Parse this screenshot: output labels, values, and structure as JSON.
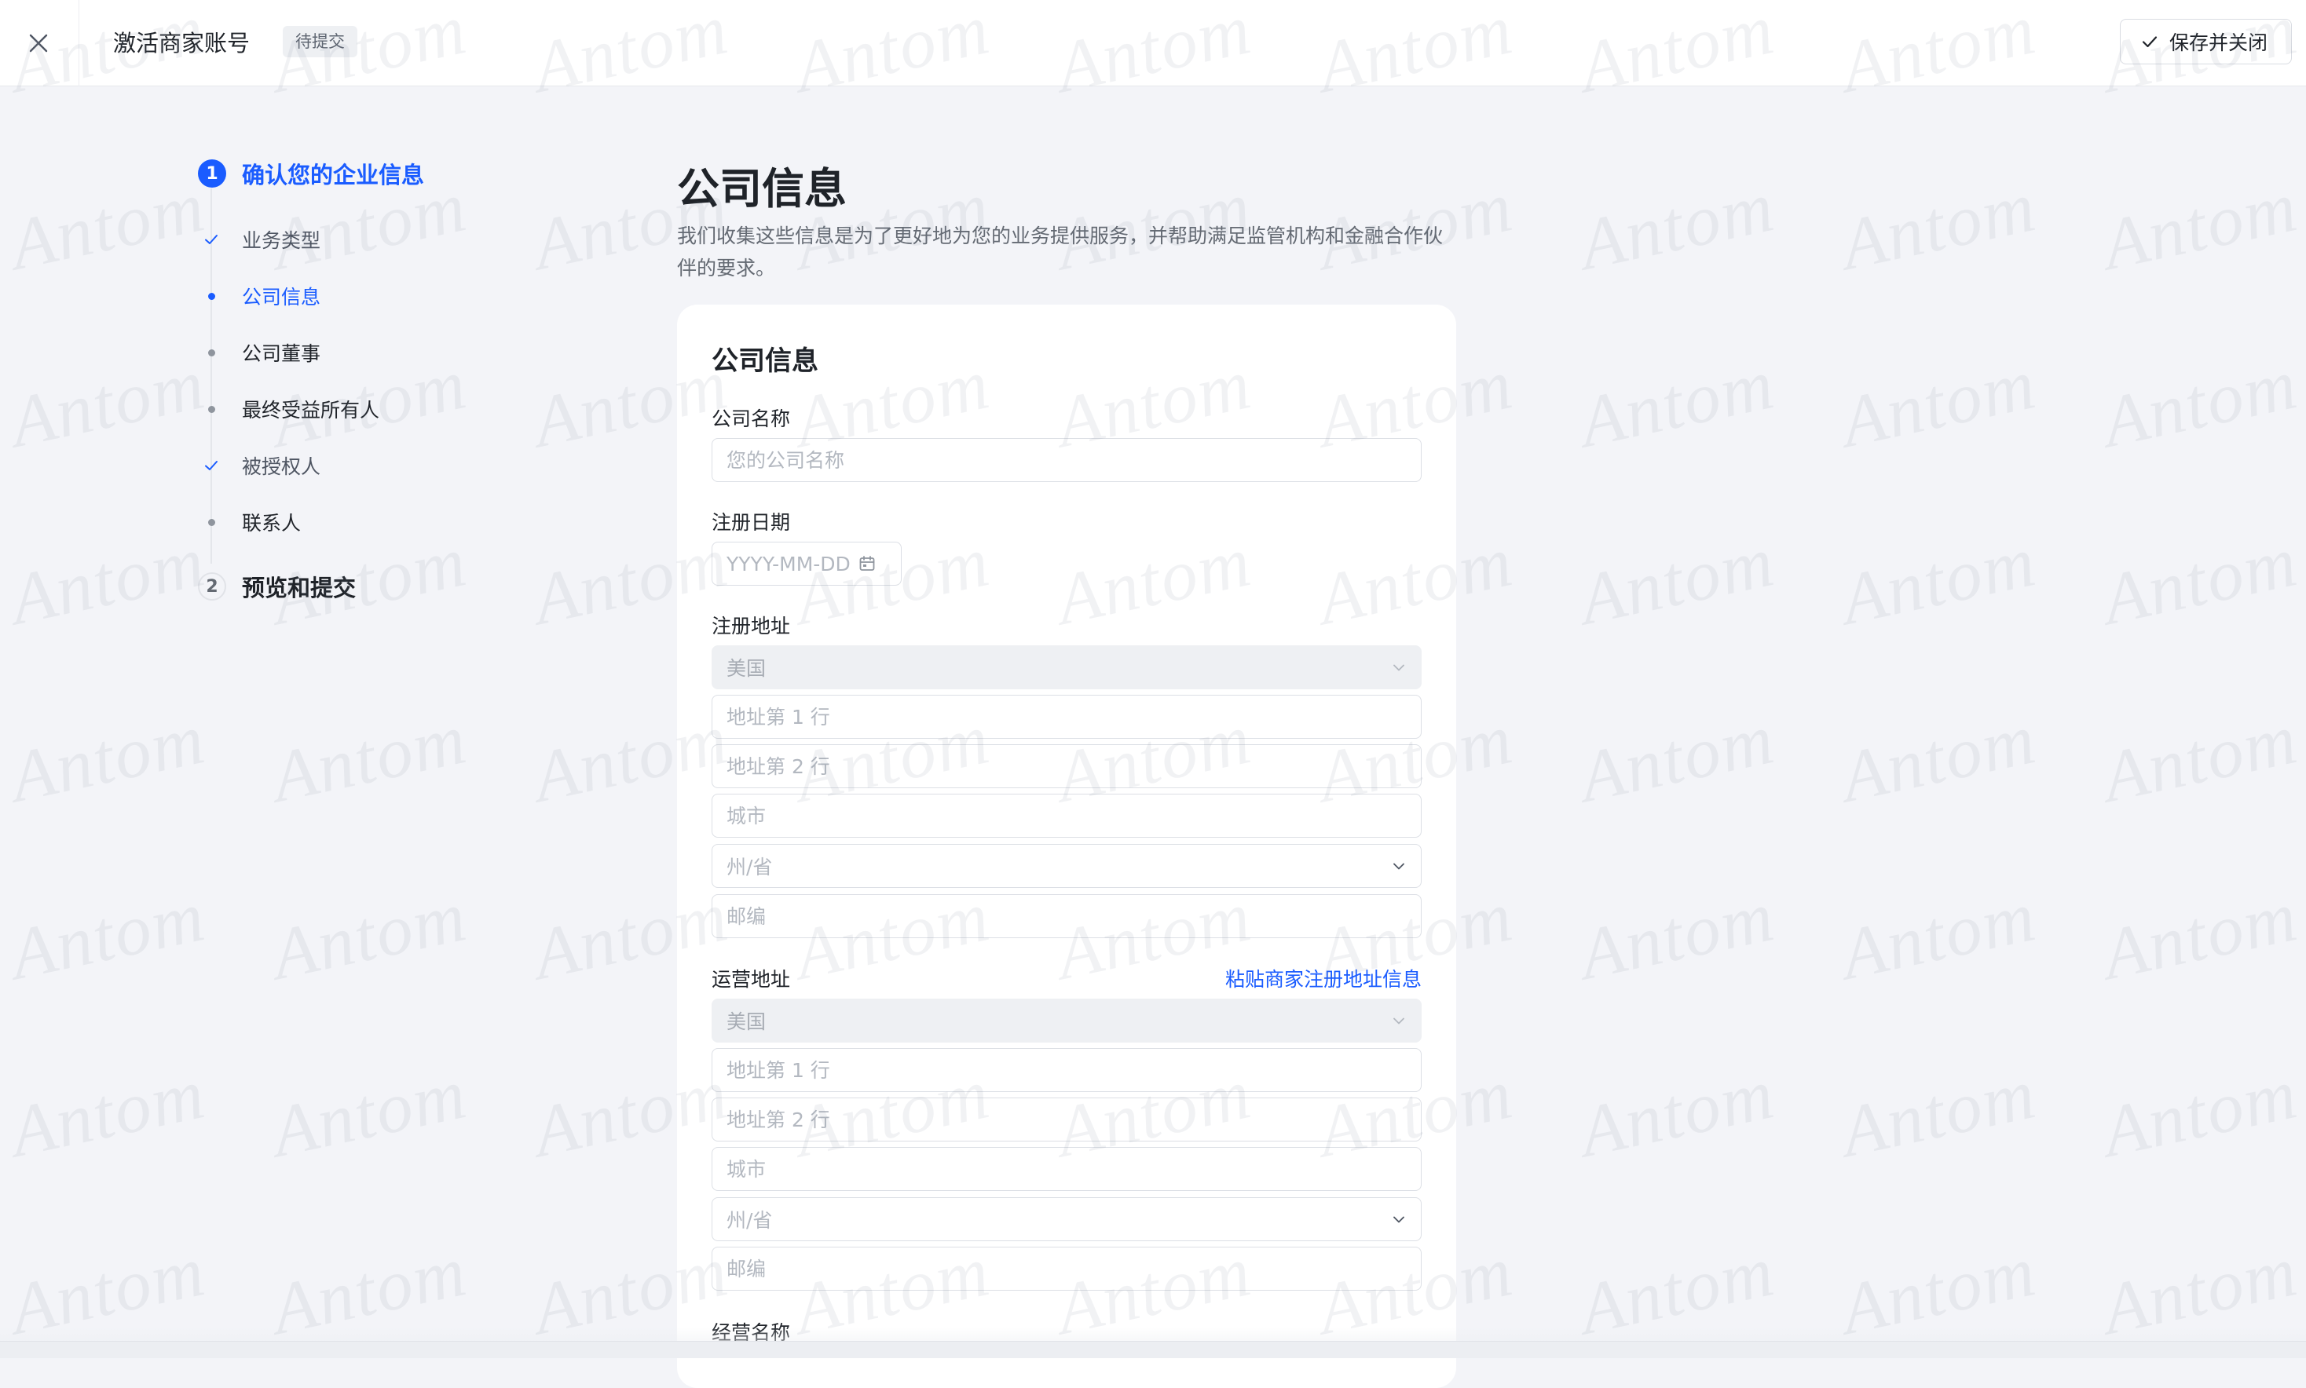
{
  "header": {
    "title": "激活商家账号",
    "status": "待提交",
    "save_close_label": "保存并关闭"
  },
  "stepper": {
    "steps": [
      {
        "number": "1",
        "label": "确认您的企业信息",
        "state": "active"
      },
      {
        "number": "2",
        "label": "预览和提交",
        "state": "inactive"
      }
    ],
    "substeps": [
      {
        "label": "业务类型",
        "state": "done"
      },
      {
        "label": "公司信息",
        "state": "current"
      },
      {
        "label": "公司董事",
        "state": "todo"
      },
      {
        "label": "最终受益所有人",
        "state": "todo"
      },
      {
        "label": "被授权人",
        "state": "done"
      },
      {
        "label": "联系人",
        "state": "todo"
      }
    ]
  },
  "main": {
    "title": "公司信息",
    "description": "我们收集这些信息是为了更好地为您的业务提供服务，并帮助满足监管机构和金融合作伙伴的要求。",
    "card": {
      "title": "公司信息",
      "company_name": {
        "label": "公司名称",
        "placeholder": "您的公司名称"
      },
      "registration_date": {
        "label": "注册日期",
        "placeholder": "YYYY-MM-DD"
      },
      "registered_address": {
        "label": "注册地址",
        "country": "美国",
        "line1_placeholder": "地址第 1 行",
        "line2_placeholder": "地址第 2 行",
        "city_placeholder": "城市",
        "state_placeholder": "州/省",
        "zip_placeholder": "邮编"
      },
      "operating_address": {
        "label": "运营地址",
        "paste_link": "粘贴商家注册地址信息",
        "country": "美国",
        "line1_placeholder": "地址第 1 行",
        "line2_placeholder": "地址第 2 行",
        "city_placeholder": "城市",
        "state_placeholder": "州/省",
        "zip_placeholder": "邮编"
      },
      "business_name": {
        "label": "经营名称"
      }
    }
  },
  "watermark": {
    "text": "Antom",
    "color": "#788296"
  },
  "colors": {
    "accent": "#1a5cff",
    "background": "#f3f4f8",
    "card": "#ffffff"
  }
}
